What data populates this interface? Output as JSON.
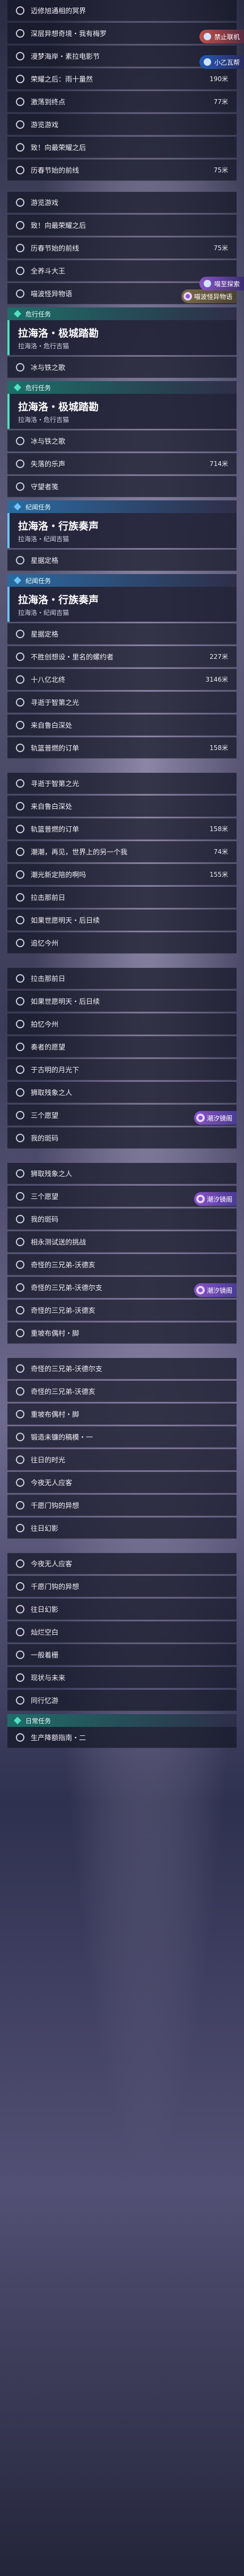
{
  "colors": {
    "teal": "#4fe0c0",
    "blue": "#6cc4ff",
    "purple_badge": "#8a53c9",
    "row_bg": "#14162680"
  },
  "header_bubbles": {
    "notice_a": "禁止联机",
    "notice_b": "小乙瓦帮",
    "notice_c": "喵至探索"
  },
  "rows_a": [
    {
      "label": "迈修旭通相的冥界",
      "meta": ""
    },
    {
      "label": "深层异想奇境・我有梅罗",
      "meta": "295米"
    },
    {
      "label": "漫梦海岸・素拉电影节",
      "meta": ""
    },
    {
      "label": "荣耀之后：雨十量然",
      "meta": "190米"
    },
    {
      "label": "激荡到终点",
      "meta": "77米"
    },
    {
      "label": "游览游戏",
      "meta": ""
    },
    {
      "label": "致！向最荣耀之后",
      "meta": ""
    },
    {
      "label": "历春节始的前线",
      "meta": "75米"
    }
  ],
  "rows_b": [
    {
      "label": "游览游戏",
      "meta": ""
    },
    {
      "label": "致！向最荣耀之后",
      "meta": ""
    },
    {
      "label": "历春节始的前线",
      "meta": "75米"
    },
    {
      "label": "全养斗大王",
      "meta": ""
    },
    {
      "label": "喵波怪异物语",
      "meta": "",
      "badge": "喵波怪异物语"
    }
  ],
  "section_1": {
    "label": "危行任务",
    "card_title": "拉海洛・极城踏勘",
    "card_sub": "拉海洛・危行吉猫"
  },
  "row_s1": {
    "label": "冰与铁之歌",
    "meta": ""
  },
  "section_2": {
    "label": "危行任务",
    "card_title": "拉海洛・极城踏勘",
    "card_sub": "拉海洛・危行吉猫"
  },
  "rows_s2": [
    {
      "label": "冰与铁之歌",
      "meta": ""
    },
    {
      "label": "失落的乐声",
      "meta": "714米"
    },
    {
      "label": "守望者笺",
      "meta": ""
    }
  ],
  "section_3": {
    "label": "纪闻任务",
    "card_title": "拉海洛・行族奏声",
    "card_sub": "拉海洛・纪闻吉猫"
  },
  "row_s3": {
    "label": "星据定格",
    "meta": ""
  },
  "section_4": {
    "label": "纪闻任务",
    "card_title": "拉海洛・行族奏声",
    "card_sub": "拉海洛・纪闻吉猫"
  },
  "rows_s4": [
    {
      "label": "星据定格",
      "meta": ""
    },
    {
      "label": "不胜创想设・里名的螺约者",
      "meta": "227米"
    },
    {
      "label": "十八亿北终",
      "meta": "3146米"
    },
    {
      "label": "寻逝于智第之光",
      "meta": ""
    },
    {
      "label": "来自鲁白深处",
      "meta": ""
    },
    {
      "label": "轨篮普燃的订单",
      "meta": "158米"
    }
  ],
  "rows_c": [
    {
      "label": "寻逝于智第之光",
      "meta": ""
    },
    {
      "label": "来自鲁白深处",
      "meta": ""
    },
    {
      "label": "轨篮普燃的订单",
      "meta": "158米"
    },
    {
      "label": "潮潮，再见，世界上的另一个我",
      "meta": "74米"
    },
    {
      "label": "潮光新定陪的啊吗",
      "meta": "155米"
    },
    {
      "label": "拉击那前日",
      "meta": ""
    },
    {
      "label": "如果世愿明天・后日续",
      "meta": ""
    },
    {
      "label": "追忆今州",
      "meta": ""
    }
  ],
  "rows_d": [
    {
      "label": "拉击那前日",
      "meta": ""
    },
    {
      "label": "如果世愿明天・后日续",
      "meta": ""
    },
    {
      "label": "拍忆今州",
      "meta": ""
    },
    {
      "label": "奏者的愿望",
      "meta": ""
    },
    {
      "label": "于古明的月光下",
      "meta": ""
    },
    {
      "label": "狮取残象之人",
      "meta": ""
    },
    {
      "label": "三个愿望",
      "meta": "",
      "badge": "潮汐镜阁"
    },
    {
      "label": "我的斑码",
      "meta": ""
    }
  ],
  "rows_e": [
    {
      "label": "狮取残象之人",
      "meta": ""
    },
    {
      "label": "三个愿望",
      "meta": "",
      "badge": "潮汐镜阁"
    },
    {
      "label": "我的斑码",
      "meta": ""
    },
    {
      "label": "相永测试送的挑战",
      "meta": ""
    },
    {
      "label": "奇怪的三兄弟-沃德亥",
      "meta": ""
    },
    {
      "label": "奇怪的三兄弟-沃德尔支",
      "meta": "",
      "badge": "潮汐镜阁"
    },
    {
      "label": "奇怪的三兄弟-沃德亥",
      "meta": ""
    },
    {
      "label": "重坡布偶村・脚",
      "meta": ""
    }
  ],
  "rows_f": [
    {
      "label": "奇怪的三兄弟-沃德尔支",
      "meta": ""
    },
    {
      "label": "奇怪的三兄弟-沃德亥",
      "meta": ""
    },
    {
      "label": "重坡布偶村・脚",
      "meta": ""
    },
    {
      "label": "锻造未镰的稿模・一",
      "meta": ""
    },
    {
      "label": "往日的时光",
      "meta": ""
    },
    {
      "label": "今夜无人应客",
      "meta": ""
    },
    {
      "label": "千愿门钩的异想",
      "meta": ""
    },
    {
      "label": "往日幻影",
      "meta": ""
    }
  ],
  "rows_g": [
    {
      "label": "今夜无人应客",
      "meta": ""
    },
    {
      "label": "千愿门钩的异想",
      "meta": ""
    },
    {
      "label": "往日幻影",
      "meta": ""
    },
    {
      "label": "灿烂空白",
      "meta": ""
    },
    {
      "label": "一般着栅",
      "meta": ""
    },
    {
      "label": "现状与未来",
      "meta": ""
    },
    {
      "label": "同行忆游",
      "meta": ""
    }
  ],
  "section_5": {
    "label": "日常任务"
  },
  "row_last": {
    "label": "生产降额指南・二",
    "meta": ""
  }
}
